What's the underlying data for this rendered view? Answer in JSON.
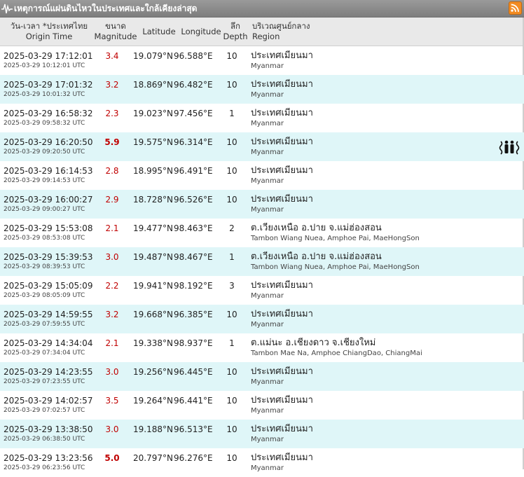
{
  "title": "เหตุการณ์แผ่นดินไหวในประเทศและใกล้เคียงล่าสุด",
  "columns": {
    "time_th": "วัน-เวลา *ประเทศไทย",
    "time_en": "Origin Time",
    "mag_th": "ขนาด",
    "mag_en": "Magnitude",
    "lat": "Latitude",
    "lon": "Longitude",
    "depth_th": "ลึก",
    "depth_en": "Depth",
    "region_th": "บริเวณศูนย์กลาง",
    "region_en": "Region"
  },
  "colors": {
    "magnitude": "#c00000",
    "alt_row": "#dff6f8",
    "rss": "#f28b22"
  },
  "rows": [
    {
      "local": "2025-03-29 17:12:01",
      "utc": "2025-03-29 10:12:01 UTC",
      "mag": "3.4",
      "lat": "19.079°N",
      "lon": "96.588°E",
      "depth": "10",
      "region_th": "ประเทศเมียนมา",
      "region_en": "Myanmar"
    },
    {
      "local": "2025-03-29 17:01:32",
      "utc": "2025-03-29 10:01:32 UTC",
      "mag": "3.2",
      "lat": "18.869°N",
      "lon": "96.482°E",
      "depth": "10",
      "region_th": "ประเทศเมียนมา",
      "region_en": "Myanmar"
    },
    {
      "local": "2025-03-29 16:58:32",
      "utc": "2025-03-29 09:58:32 UTC",
      "mag": "2.3",
      "lat": "19.023°N",
      "lon": "97.456°E",
      "depth": "1",
      "region_th": "ประเทศเมียนมา",
      "region_en": "Myanmar"
    },
    {
      "local": "2025-03-29 16:20:50",
      "utc": "2025-03-29 09:20:50 UTC",
      "mag": "5.9",
      "lat": "19.575°N",
      "lon": "96.314°E",
      "depth": "10",
      "region_th": "ประเทศเมียนมา",
      "region_en": "Myanmar",
      "felt": true
    },
    {
      "local": "2025-03-29 16:14:53",
      "utc": "2025-03-29 09:14:53 UTC",
      "mag": "2.8",
      "lat": "18.995°N",
      "lon": "96.491°E",
      "depth": "10",
      "region_th": "ประเทศเมียนมา",
      "region_en": "Myanmar"
    },
    {
      "local": "2025-03-29 16:00:27",
      "utc": "2025-03-29 09:00:27 UTC",
      "mag": "2.9",
      "lat": "18.728°N",
      "lon": "96.526°E",
      "depth": "10",
      "region_th": "ประเทศเมียนมา",
      "region_en": "Myanmar"
    },
    {
      "local": "2025-03-29 15:53:08",
      "utc": "2025-03-29 08:53:08 UTC",
      "mag": "2.1",
      "lat": "19.477°N",
      "lon": "98.463°E",
      "depth": "2",
      "region_th": "ต.เวียงเหนือ อ.ปาย จ.แม่ฮ่องสอน",
      "region_en": "Tambon Wiang Nuea, Amphoe Pai, MaeHongSon"
    },
    {
      "local": "2025-03-29 15:39:53",
      "utc": "2025-03-29 08:39:53 UTC",
      "mag": "3.0",
      "lat": "19.487°N",
      "lon": "98.467°E",
      "depth": "1",
      "region_th": "ต.เวียงเหนือ อ.ปาย จ.แม่ฮ่องสอน",
      "region_en": "Tambon Wiang Nuea, Amphoe Pai, MaeHongSon"
    },
    {
      "local": "2025-03-29 15:05:09",
      "utc": "2025-03-29 08:05:09 UTC",
      "mag": "2.2",
      "lat": "19.941°N",
      "lon": "98.192°E",
      "depth": "3",
      "region_th": "ประเทศเมียนมา",
      "region_en": "Myanmar"
    },
    {
      "local": "2025-03-29 14:59:55",
      "utc": "2025-03-29 07:59:55 UTC",
      "mag": "3.2",
      "lat": "19.668°N",
      "lon": "96.385°E",
      "depth": "10",
      "region_th": "ประเทศเมียนมา",
      "region_en": "Myanmar"
    },
    {
      "local": "2025-03-29 14:34:04",
      "utc": "2025-03-29 07:34:04 UTC",
      "mag": "2.1",
      "lat": "19.338°N",
      "lon": "98.937°E",
      "depth": "1",
      "region_th": "ต.แม่นะ อ.เชียงดาว จ.เชียงใหม่",
      "region_en": "Tambon Mae Na, Amphoe ChiangDao, ChiangMai"
    },
    {
      "local": "2025-03-29 14:23:55",
      "utc": "2025-03-29 07:23:55 UTC",
      "mag": "3.0",
      "lat": "19.256°N",
      "lon": "96.445°E",
      "depth": "10",
      "region_th": "ประเทศเมียนมา",
      "region_en": "Myanmar"
    },
    {
      "local": "2025-03-29 14:02:57",
      "utc": "2025-03-29 07:02:57 UTC",
      "mag": "3.5",
      "lat": "19.264°N",
      "lon": "96.441°E",
      "depth": "10",
      "region_th": "ประเทศเมียนมา",
      "region_en": "Myanmar"
    },
    {
      "local": "2025-03-29 13:38:50",
      "utc": "2025-03-29 06:38:50 UTC",
      "mag": "3.0",
      "lat": "19.188°N",
      "lon": "96.513°E",
      "depth": "10",
      "region_th": "ประเทศเมียนมา",
      "region_en": "Myanmar"
    },
    {
      "local": "2025-03-29 13:23:56",
      "utc": "2025-03-29 06:23:56 UTC",
      "mag": "5.0",
      "lat": "20.797°N",
      "lon": "96.276°E",
      "depth": "10",
      "region_th": "ประเทศเมียนมา",
      "region_en": "Myanmar"
    }
  ]
}
